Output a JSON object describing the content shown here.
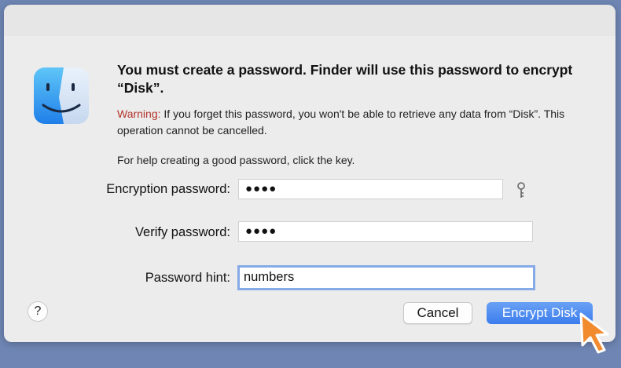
{
  "dialog": {
    "heading": "You must create a password. Finder will use this password to encrypt “Disk”.",
    "warning_label": "Warning:",
    "warning_text": " If you forget this password, you won't be able to retrieve any data from “Disk”. This operation cannot be cancelled.",
    "help_text": "For help creating a good password, click the key."
  },
  "form": {
    "encryption_label": "Encryption password:",
    "encryption_value": "●●●●",
    "verify_label": "Verify password:",
    "verify_value": "●●●●",
    "hint_label": "Password hint:",
    "hint_value": "numbers"
  },
  "buttons": {
    "help": "?",
    "cancel": "Cancel",
    "encrypt": "Encrypt Disk"
  },
  "icons": {
    "app_icon": "finder-icon",
    "key": "key-icon",
    "cursor": "pointer-cursor-icon"
  },
  "colors": {
    "accent": "#3c7ded",
    "warning": "#b3342b",
    "focus_ring": "#86a9e8"
  }
}
